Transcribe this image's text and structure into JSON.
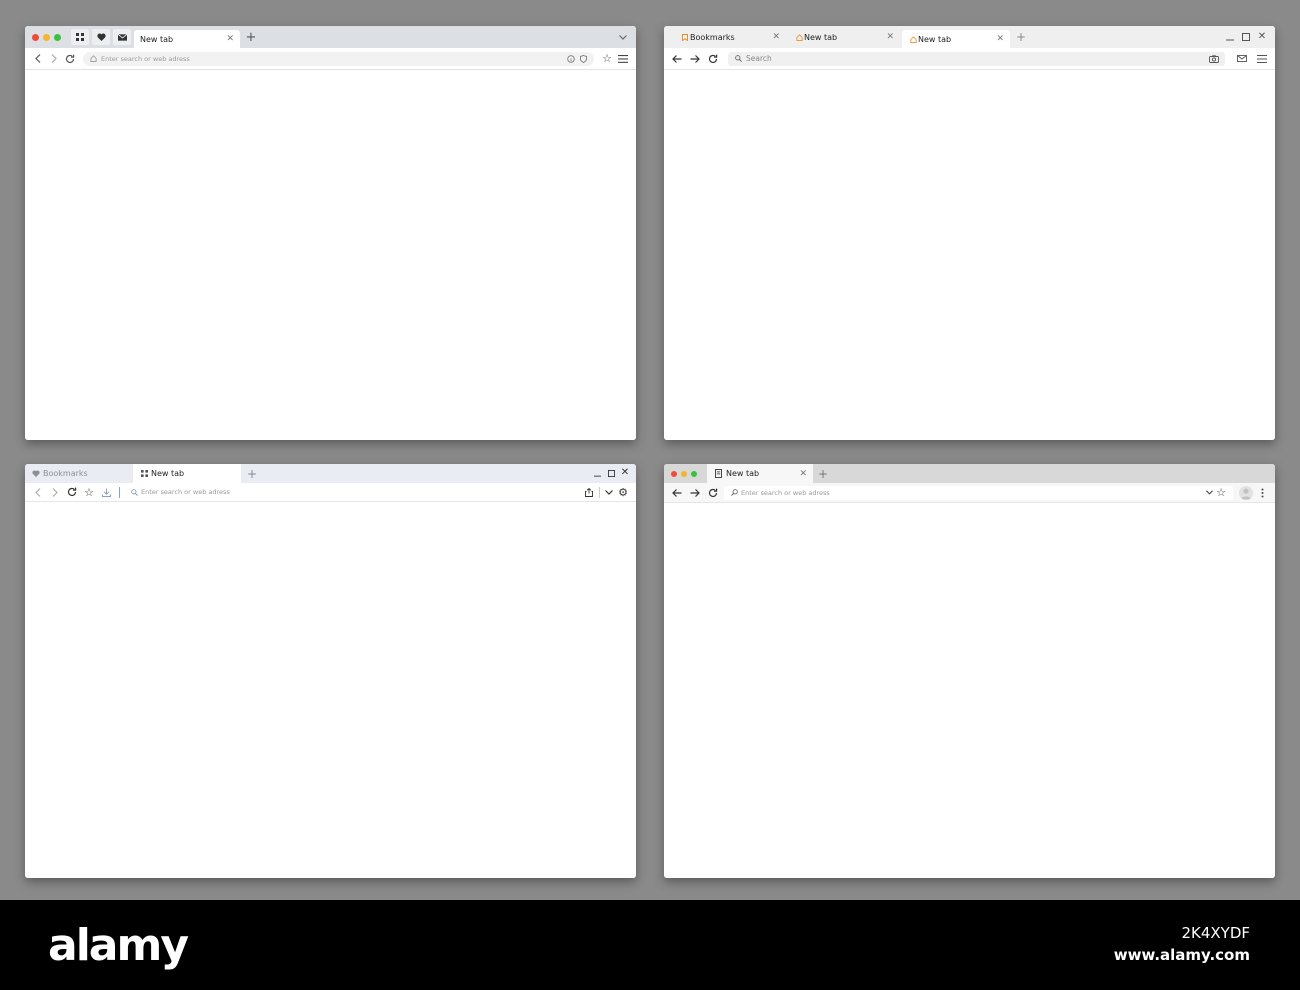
{
  "windows": [
    {
      "tabs": [
        {
          "label": "New tab"
        }
      ],
      "address": {
        "placeholder": "Enter search or web adress"
      }
    },
    {
      "tabs": [
        {
          "label": "Bookmarks"
        },
        {
          "label": "New tab"
        },
        {
          "label": "New tab"
        }
      ],
      "address": {
        "placeholder": "Search"
      }
    },
    {
      "tabs": [
        {
          "label": "Bookmarks"
        },
        {
          "label": "New tab"
        }
      ],
      "address": {
        "placeholder": "Enter search or web adress"
      }
    },
    {
      "tabs": [
        {
          "label": "New tab"
        }
      ],
      "address": {
        "placeholder": "Enter search or web adress"
      }
    }
  ],
  "footer": {
    "brand": "alamy",
    "stock_id": "2K4XYDF",
    "site": "www.alamy.com"
  },
  "colors": {
    "background": "#8a8a8a",
    "close_dot": "#ee4b3b",
    "min_dot": "#f5b52d",
    "max_dot": "#3cc13c",
    "orange_tab_icon": "#e8902a"
  },
  "icons": [
    "grid-icon",
    "heart-icon",
    "mail-icon",
    "plus-icon",
    "back-icon",
    "forward-icon",
    "reload-icon",
    "home-icon",
    "info-icon",
    "shield-icon",
    "star-icon",
    "menu-icon",
    "bookmark-icon",
    "search-icon",
    "camera-icon",
    "minimize-icon",
    "maximize-icon",
    "close-icon",
    "download-icon",
    "share-icon",
    "chevron-down-icon",
    "gear-icon",
    "page-icon",
    "avatar-icon",
    "kebab-icon"
  ]
}
